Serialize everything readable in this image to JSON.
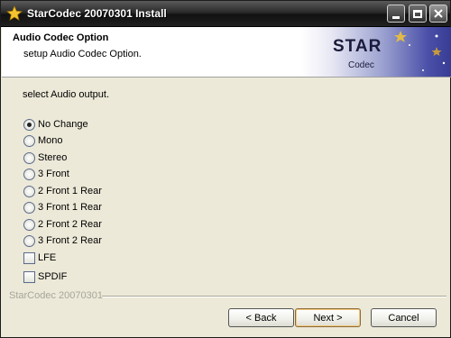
{
  "window": {
    "title": "StarCodec 20070301 Install"
  },
  "header": {
    "title": "Audio Codec Option",
    "subtitle": "setup Audio Codec Option.",
    "banner": {
      "line1": "STAR",
      "line2": "Codec"
    }
  },
  "main": {
    "prompt": "select Audio output.",
    "options": [
      {
        "label": "No Change",
        "selected": true
      },
      {
        "label": "Mono",
        "selected": false
      },
      {
        "label": "Stereo",
        "selected": false
      },
      {
        "label": "3 Front",
        "selected": false
      },
      {
        "label": "2 Front 1 Rear",
        "selected": false
      },
      {
        "label": "3 Front 1 Rear",
        "selected": false
      },
      {
        "label": "2 Front 2 Rear",
        "selected": false
      },
      {
        "label": "3 Front 2 Rear",
        "selected": false
      }
    ],
    "checkboxes": [
      {
        "label": "LFE",
        "checked": false
      },
      {
        "label": "SPDIF",
        "checked": false
      }
    ]
  },
  "footer": {
    "brand": "StarCodec 20070301",
    "back_label": "< Back",
    "next_label": "Next >",
    "cancel_label": "Cancel"
  },
  "colors": {
    "titlebar": "#1a1a1a",
    "dialog_bg": "#ece9d8",
    "banner_blue": "#4a4fa8"
  }
}
